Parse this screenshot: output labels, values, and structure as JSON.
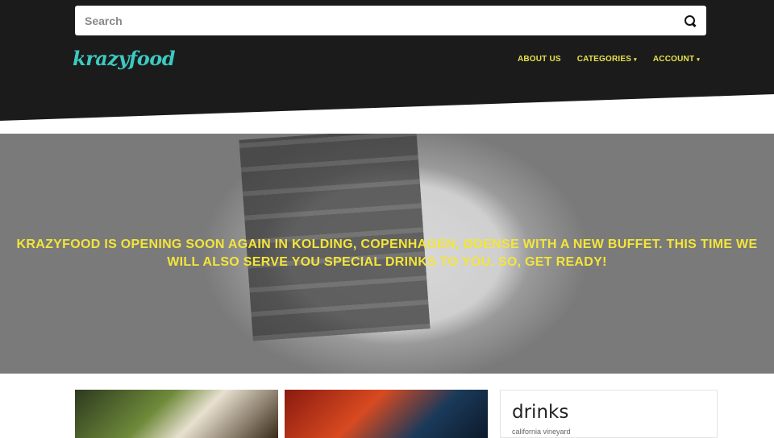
{
  "search": {
    "placeholder": "Search"
  },
  "brand": {
    "logo": "krazyfood"
  },
  "nav": {
    "about": "ABOUT US",
    "categories": "CATEGORIES",
    "account": "ACCOUNT",
    "caret": "▾"
  },
  "hero": {
    "text": "KRAZYFOOD IS OPENING SOON AGAIN IN KOLDING, COPENHAGEN, ØDENSE WITH A NEW BUFFET. THIS TIME WE WILL ALSO SERVE YOU SPECIAL DRINKS TO YOU. SO, GET READY!"
  },
  "drinks": {
    "title": "drinks",
    "subtitle": "california vineyard"
  },
  "colors": {
    "header": "#1b1b1b",
    "logo": "#3cc9c0",
    "accent": "#e8e24a"
  }
}
